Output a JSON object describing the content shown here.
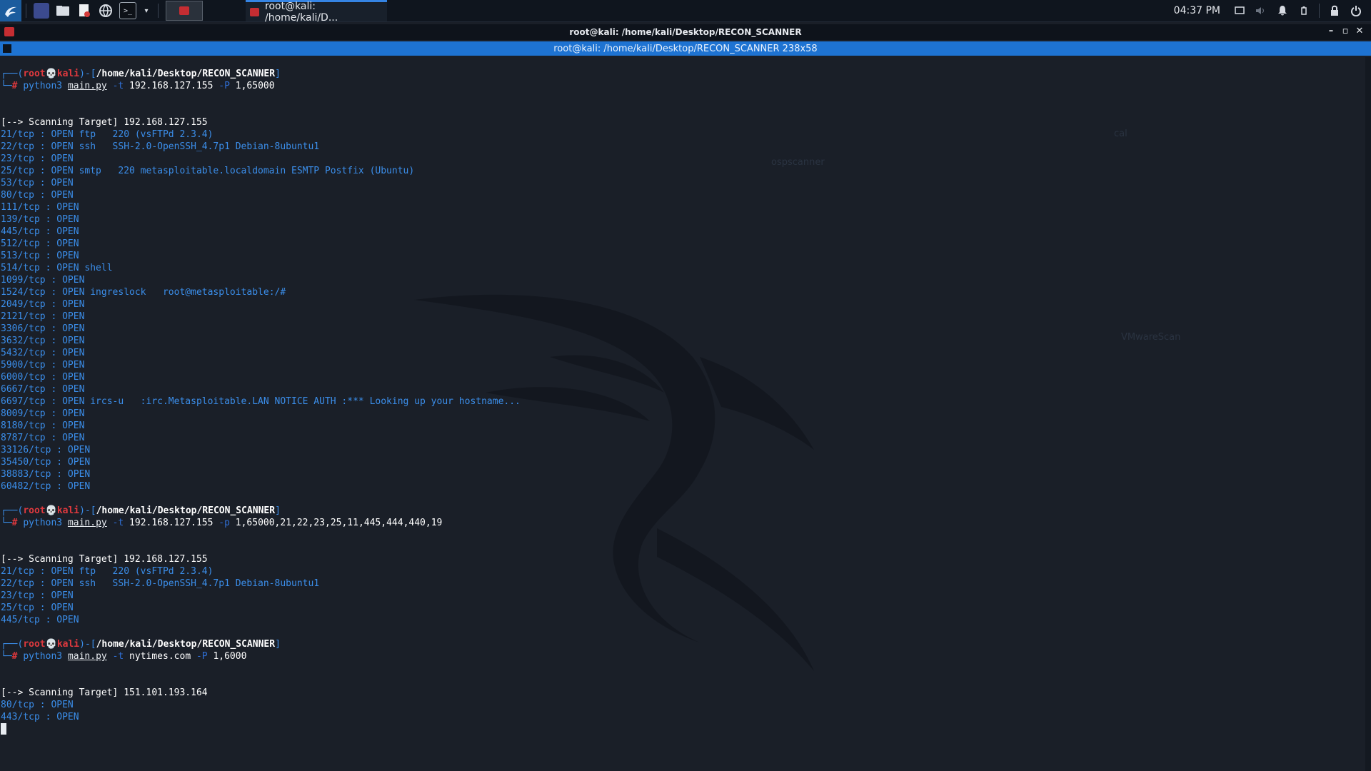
{
  "taskbar": {
    "task_title": "root@kali: /home/kali/D...",
    "clock": "04:37 PM",
    "icons": [
      "kali-menu-icon",
      "workspace-icon",
      "file-manager-icon",
      "text-editor-icon",
      "browser-icon",
      "terminal-icon",
      "chevron-down-icon",
      "active-terminal-icon",
      "display-icon",
      "volume-icon",
      "bell-icon",
      "battery-icon",
      "lock-icon",
      "power-icon"
    ]
  },
  "window": {
    "title": "root@kali: /home/kali/Desktop/RECON_SCANNER",
    "tab_title": "root@kali: /home/kali/Desktop/RECON_SCANNER 238x58",
    "controls": [
      "minimize",
      "maximize",
      "close"
    ]
  },
  "prompt": {
    "user": "root",
    "host": "kali",
    "path": "/home/kali/Desktop/RECON_SCANNER"
  },
  "sessions": [
    {
      "cmd": "python3",
      "script": "main.py",
      "t_flag": "-t",
      "target": "192.168.127.155",
      "p_flag": "-P",
      "ports": "1,65000",
      "scan_label": "[--> Scanning Target]",
      "scan_ip": "192.168.127.155",
      "results": [
        {
          "port": "21/tcp : OPEN",
          "svc": "ftp   220 (vsFTPd 2.3.4)"
        },
        {
          "port": "22/tcp : OPEN",
          "svc": "ssh   SSH-2.0-OpenSSH_4.7p1 Debian-8ubuntu1"
        },
        {
          "port": "23/tcp : OPEN",
          "svc": ""
        },
        {
          "port": "25/tcp : OPEN",
          "svc": "smtp   220 metasploitable.localdomain ESMTP Postfix (Ubuntu)"
        },
        {
          "port": "53/tcp : OPEN",
          "svc": ""
        },
        {
          "port": "80/tcp : OPEN",
          "svc": ""
        },
        {
          "port": "111/tcp : OPEN",
          "svc": ""
        },
        {
          "port": "139/tcp : OPEN",
          "svc": ""
        },
        {
          "port": "445/tcp : OPEN",
          "svc": ""
        },
        {
          "port": "512/tcp : OPEN",
          "svc": ""
        },
        {
          "port": "513/tcp : OPEN",
          "svc": ""
        },
        {
          "port": "514/tcp : OPEN",
          "svc": "shell"
        },
        {
          "port": "1099/tcp : OPEN",
          "svc": ""
        },
        {
          "port": "1524/tcp : OPEN",
          "svc": "ingreslock   root@metasploitable:/#"
        },
        {
          "port": "2049/tcp : OPEN",
          "svc": ""
        },
        {
          "port": "2121/tcp : OPEN",
          "svc": ""
        },
        {
          "port": "3306/tcp : OPEN",
          "svc": ""
        },
        {
          "port": "3632/tcp : OPEN",
          "svc": ""
        },
        {
          "port": "5432/tcp : OPEN",
          "svc": ""
        },
        {
          "port": "5900/tcp : OPEN",
          "svc": ""
        },
        {
          "port": "6000/tcp : OPEN",
          "svc": ""
        },
        {
          "port": "6667/tcp : OPEN",
          "svc": ""
        },
        {
          "port": "6697/tcp : OPEN",
          "svc": "ircs-u   :irc.Metasploitable.LAN NOTICE AUTH :*** Looking up your hostname..."
        },
        {
          "port": "8009/tcp : OPEN",
          "svc": ""
        },
        {
          "port": "8180/tcp : OPEN",
          "svc": ""
        },
        {
          "port": "8787/tcp : OPEN",
          "svc": ""
        },
        {
          "port": "33126/tcp : OPEN",
          "svc": ""
        },
        {
          "port": "35450/tcp : OPEN",
          "svc": ""
        },
        {
          "port": "38883/tcp : OPEN",
          "svc": ""
        },
        {
          "port": "60482/tcp : OPEN",
          "svc": ""
        }
      ]
    },
    {
      "cmd": "python3",
      "script": "main.py",
      "t_flag": "-t",
      "target": "192.168.127.155",
      "p_flag": "-p",
      "ports": "1,65000,21,22,23,25,11,445,444,440,19",
      "scan_label": "[--> Scanning Target]",
      "scan_ip": "192.168.127.155",
      "results": [
        {
          "port": "21/tcp : OPEN",
          "svc": "ftp   220 (vsFTPd 2.3.4)"
        },
        {
          "port": "22/tcp : OPEN",
          "svc": "ssh   SSH-2.0-OpenSSH_4.7p1 Debian-8ubuntu1"
        },
        {
          "port": "23/tcp : OPEN",
          "svc": ""
        },
        {
          "port": "25/tcp : OPEN",
          "svc": ""
        },
        {
          "port": "445/tcp : OPEN",
          "svc": ""
        }
      ]
    },
    {
      "cmd": "python3",
      "script": "main.py",
      "t_flag": "-t",
      "target": "nytimes.com",
      "p_flag": "-P",
      "ports": "1,6000",
      "scan_label": "[--> Scanning Target]",
      "scan_ip": "151.101.193.164",
      "results": [
        {
          "port": "80/tcp : OPEN",
          "svc": ""
        },
        {
          "port": "443/tcp : OPEN",
          "svc": ""
        }
      ]
    }
  ],
  "colors": {
    "bg": "#1a1f28",
    "accent": "#1e73d2",
    "prompt_red": "#e0393e",
    "output_blue": "#3b8eea"
  }
}
